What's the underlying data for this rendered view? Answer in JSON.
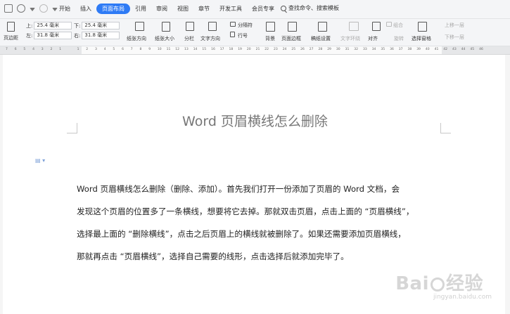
{
  "menu": {
    "tabs": [
      "开始",
      "插入",
      "页面布局",
      "引用",
      "审阅",
      "视图",
      "章节",
      "开发工具",
      "会员专享"
    ],
    "active_tab": "页面布局",
    "search_label": "查找命令、搜索模板"
  },
  "toolbar": {
    "margins_label": "页边距",
    "top_label": "上:",
    "top_value": "25.4 毫米",
    "bottom_label": "下:",
    "bottom_value": "25.4 毫米",
    "left_label": "左:",
    "left_value": "31.8 毫米",
    "right_label": "右:",
    "right_value": "31.8 毫米",
    "orientation": "纸张方向",
    "size": "纸张大小",
    "columns": "分栏",
    "text_direction": "文字方向",
    "breaks": "分隔符",
    "line_numbers": "行号",
    "background": "背景",
    "page_border": "页面边框",
    "draft_settings": "稿纸设置",
    "text_wrap": "文字环绕",
    "align": "对齐",
    "rotate": "旋转",
    "group": "组合",
    "selection_pane": "选择窗格",
    "bring_forward": "上移一层",
    "send_backward": "下移一层"
  },
  "ruler": {
    "ticks": [
      "7",
      "6",
      "5",
      "4",
      "3",
      "2",
      "1",
      "",
      "1",
      "2",
      "3",
      "4",
      "5",
      "6",
      "7",
      "8",
      "9",
      "10",
      "11",
      "12",
      "13",
      "14",
      "15",
      "16",
      "17",
      "18",
      "19",
      "20",
      "21",
      "22",
      "23",
      "24",
      "25",
      "26",
      "27",
      "28",
      "29",
      "30",
      "31",
      "32",
      "33",
      "34",
      "35",
      "36",
      "37",
      "38",
      "39",
      "40",
      "41",
      "42",
      "43",
      "44",
      "45",
      "46"
    ]
  },
  "document": {
    "header_title": "Word 页眉横线怎么删除",
    "paragraph_lines": [
      "Word 页眉横线怎么删除（删除、添加）。首先我们打开一份添加了页眉的 Word 文档，会",
      "发现这个页眉的位置多了一条横线，想要将它去掉。那就双击页眉，点击上面的 “页眉横线”，",
      "选择最上面的 “删除横线”，点击之后页眉上的横线就被删除了。如果还需要添加页眉横线，",
      "那就再点击 “页眉横线”，选择自己需要的线形，点击选择后就添加完毕了。"
    ]
  },
  "watermark": {
    "brand": "Bai",
    "brand_suffix": "经验",
    "url": "jingyan.baidu.com"
  }
}
